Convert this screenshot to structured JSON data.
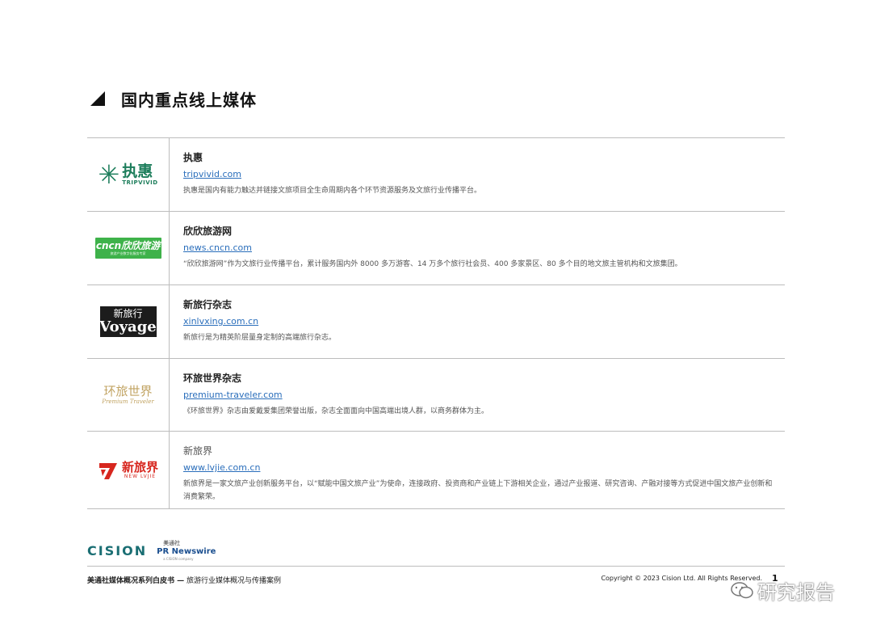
{
  "section": {
    "title": "国内重点线上媒体"
  },
  "media": [
    {
      "logo": {
        "cn": "执惠",
        "en": "TRIPVIVID"
      },
      "name": "执惠",
      "url": "tripvivid.com",
      "desc": "执惠是国内有能力触达并链接文旅项目全生命周期内各个环节资源服务及文旅行业传播平台。"
    },
    {
      "logo": {
        "main": "cncn欣欣旅游",
        "sub": "旅游产业数字化服务专家"
      },
      "name": "欣欣旅游网",
      "url": "news.cncn.com",
      "desc": "“欣欣旅游网”作为文旅行业传播平台，累计服务国内外 8000 多万游客、14 万多个旅行社会员、400 多家景区、80 多个目的地文旅主管机构和文旅集团。"
    },
    {
      "logo": {
        "top": "新旅行",
        "bottom": "Voyage"
      },
      "name": "新旅行杂志",
      "url": "xinlvxing.com.cn",
      "desc": "新旅行是为精英阶层量身定制的高端旅行杂志。"
    },
    {
      "logo": {
        "top": "环旅世界",
        "bottom": "Premium Traveler"
      },
      "name": "环旅世界杂志",
      "url": "premium-traveler.com",
      "desc": "《环旅世界》杂志由爱戴爱集团荣誉出版，杂志全面面向中国高端出境人群，以商务群体为主。"
    },
    {
      "logo": {
        "cn": "新旅界",
        "en": "NEW LVJIE"
      },
      "name": "新旅界",
      "url": "www.lvjie.com.cn",
      "desc": "新旅界是一家文旅产业创新服务平台，以“赋能中国文旅产业”为使命，连接政府、投资商和产业链上下游相关企业，通过产业报道、研究咨询、产融对接等方式促进中国文旅产业创新和消费繁荣。"
    }
  ],
  "footer": {
    "cision": "CISION",
    "prn_cn": "美通社",
    "prn_en": "PR Newswire",
    "prn_tag": "a CISION company",
    "left_bold": "美通社媒体概况系列白皮书 —",
    "left_rest": " 旅游行业媒体概况与传播案例",
    "copyright": "Copyright © 2023 Cision Ltd. All Rights Reserved.",
    "page": "1"
  },
  "watermark": {
    "text": "研究报告"
  },
  "colors": {
    "tripvivid": "#1e7e5c",
    "cncn": "#3eb24a",
    "premium": "#c1a362",
    "newlvjie": "#d7261e",
    "link": "#2a6ebb",
    "cision": "#1a6e73"
  }
}
